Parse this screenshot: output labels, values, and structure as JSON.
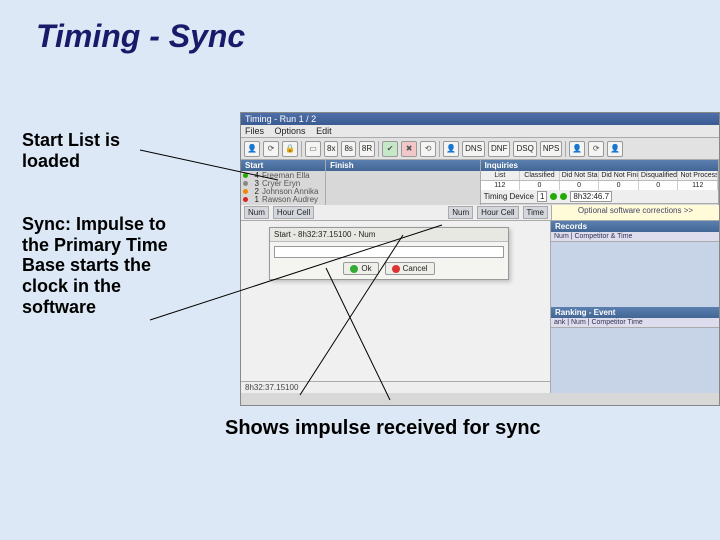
{
  "slide": {
    "title": "Timing - Sync",
    "note_startlist": "Start List is loaded",
    "note_sync": "Sync: Impulse to the Primary Time Base starts the clock in the software",
    "caption_bottom": "Shows impulse received for sync"
  },
  "app": {
    "window_title": "Timing - Run 1 / 2",
    "menu": {
      "files": "Files",
      "options": "Options",
      "edit": "Edit"
    },
    "toolbar": {
      "person": "person-icon",
      "refresh": "refresh-icon",
      "lock": "lock-icon",
      "book": "book-icon",
      "eight_x": "8x",
      "eight_s": "8s",
      "eight_r": "8R",
      "go": "go-icon",
      "stop": "stop-icon",
      "reset": "reset-icon",
      "person2": "person-icon",
      "dns": "DNS",
      "dnf": "DNF",
      "dsq": "DSQ",
      "nps": "NPS",
      "trail_a": "person-icon",
      "trail_b": "refresh-icon",
      "trail_c": "person-icon"
    },
    "columns": {
      "start": "Start",
      "finish": "Finish",
      "inquiries": "Inquiries"
    },
    "start_list": [
      {
        "dot": "d-green",
        "num": "4",
        "name": "Freeman Ella"
      },
      {
        "dot": "d-gray",
        "num": "3",
        "name": "Cryer Eryn"
      },
      {
        "dot": "d-orange",
        "num": "2",
        "name": "Johnson Annika"
      },
      {
        "dot": "d-red",
        "num": "1",
        "name": "Rawson Audrey"
      }
    ],
    "inquiries": {
      "headers": [
        "List",
        "Classified",
        "Did Not Start",
        "Did Not Finish",
        "Disqualified",
        "Not Processed"
      ],
      "values": [
        "112",
        "0",
        "0",
        "0",
        "0",
        "112"
      ]
    },
    "timing_device": {
      "label": "Timing Device",
      "id": "1",
      "time": "8h32:46.7"
    },
    "optional_strip": "Optional software corrections >>",
    "subbar": {
      "num": "Num",
      "hour_cell": "Hour Cell",
      "num2": "Num",
      "hour_cell2": "Hour Cell",
      "time": "Time"
    },
    "dialog": {
      "title": "Start - 8h32:37.15100 - Num",
      "ok": "Ok",
      "cancel": "Cancel"
    },
    "status": "8h32:37.15100",
    "records": {
      "title": "Records",
      "cols": "Num | Competitor & Time"
    },
    "ranking": {
      "title": "Ranking - Event",
      "cols": "ank | Num | Competitor                              Time"
    }
  }
}
